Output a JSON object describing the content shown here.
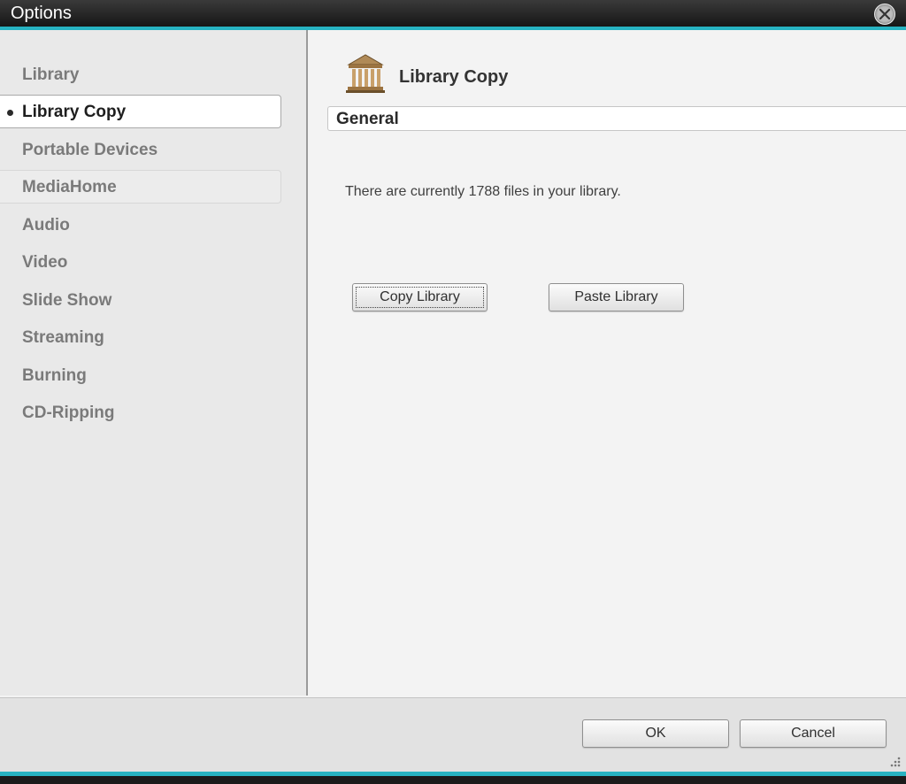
{
  "window": {
    "title": "Options",
    "close_icon": "close-circle-icon",
    "accent_color": "#27b3c2"
  },
  "sidebar": {
    "items": [
      {
        "label": "Library",
        "state": "normal"
      },
      {
        "label": "Library Copy",
        "state": "selected"
      },
      {
        "label": "Portable Devices",
        "state": "normal"
      },
      {
        "label": "MediaHome",
        "state": "hover"
      },
      {
        "label": "Audio",
        "state": "normal"
      },
      {
        "label": "Video",
        "state": "normal"
      },
      {
        "label": "Slide Show",
        "state": "normal"
      },
      {
        "label": "Streaming",
        "state": "normal"
      },
      {
        "label": "Burning",
        "state": "normal"
      },
      {
        "label": "CD-Ripping",
        "state": "normal"
      }
    ]
  },
  "content": {
    "icon": "library-building-icon",
    "title": "Library Copy",
    "section_label": "General",
    "info_text": "There are currently 1788 files in your library.",
    "copy_button": "Copy Library",
    "paste_button": "Paste Library"
  },
  "footer": {
    "ok_label": "OK",
    "cancel_label": "Cancel"
  }
}
